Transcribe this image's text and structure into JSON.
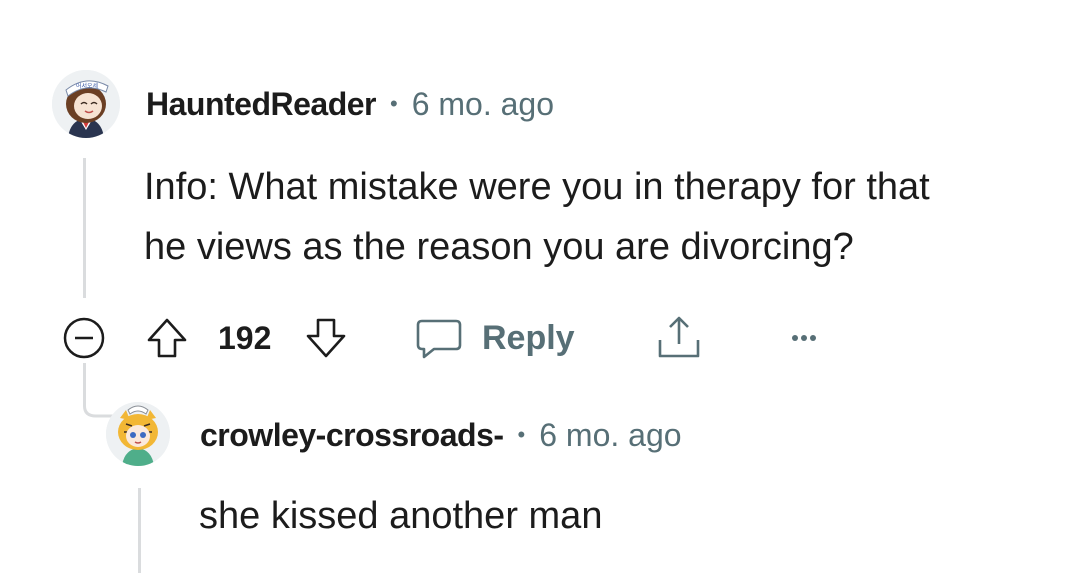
{
  "comment": {
    "username": "HauntedReader",
    "separator": "•",
    "timestamp": "6 mo. ago",
    "body_line1": "Info: What mistake were you in therapy for that",
    "body_line2": "he views as the reason you are divorcing?",
    "avatar_cap_text": "어서오세",
    "actions": {
      "collapse_icon": "minus-circle-icon",
      "upvote_icon": "arrow-up-icon",
      "vote_count": "192",
      "downvote_icon": "arrow-down-icon",
      "reply_icon": "speech-bubble-icon",
      "reply_label": "Reply",
      "share_icon": "share-icon",
      "more_icon": "more-horizontal-icon"
    }
  },
  "reply": {
    "username": "crowley-crossroads-",
    "separator": "•",
    "timestamp": "6 mo. ago",
    "body": "she kissed another man"
  },
  "colors": {
    "text_primary": "#1c1c1c",
    "text_secondary": "#576f76",
    "thread_line": "#dadcde"
  }
}
